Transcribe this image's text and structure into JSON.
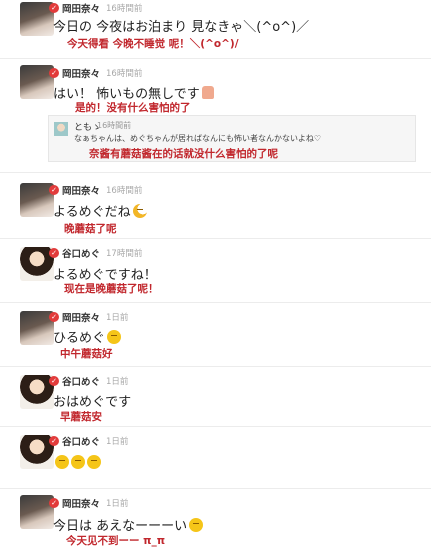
{
  "posts": [
    {
      "user": "岡田奈々",
      "time": "16時間前",
      "text": "今日の 今夜はお泊まり 見なきゃ＼(^o^)／",
      "translation": "今天得看 今晚不睡觉 呢！＼(^o^)/"
    },
    {
      "user": "岡田奈々",
      "time": "16時間前",
      "text": "はい！ 怖いもの無しです",
      "translation": "是的！没有什么害怕的了",
      "quote": {
        "user": "ともゝ",
        "time": "16時間前",
        "text": "なぁちゃんは、めぐちゃんが居ればなんにも怖い者なんかないよね♡",
        "translation": "奈酱有蘑菇酱在的话就没什么害怕的了呢"
      }
    },
    {
      "user": "岡田奈々",
      "time": "16時間前",
      "text": "よるめぐだね",
      "translation": "晚蘑菇了呢"
    },
    {
      "user": "谷口めぐ",
      "time": "17時間前",
      "text": "よるめぐですね！",
      "translation": "现在是晚蘑菇了呢！"
    },
    {
      "user": "岡田奈々",
      "time": "1日前",
      "text": "ひるめぐ",
      "translation": "中午蘑菇好"
    },
    {
      "user": "谷口めぐ",
      "time": "1日前",
      "text": "おはめぐです",
      "translation": "早蘑菇安"
    },
    {
      "user": "谷口めぐ",
      "time": "1日前",
      "text": "",
      "translation": ""
    },
    {
      "user": "岡田奈々",
      "time": "1日前",
      "text": "今日は あえなーーーい",
      "translation": "今天见不到ーー π_π"
    }
  ],
  "icons": {
    "badge": "verified-badge-icon",
    "emoji": "smiley-emoji-icon",
    "moon": "moon-emoji-icon",
    "thumb": "thumbs-up-emoji-icon"
  },
  "colors": {
    "translation": "#c1272d",
    "timestamp": "#a9a9a9",
    "badge": "#e23b3b"
  }
}
